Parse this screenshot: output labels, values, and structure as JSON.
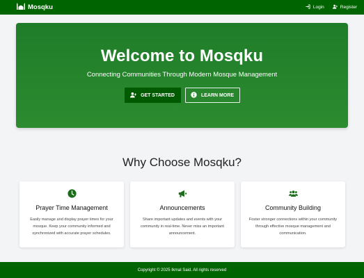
{
  "navbar": {
    "brand": "Mosqku",
    "login_label": "Login",
    "register_label": "Register"
  },
  "hero": {
    "title": "Welcome to Mosqku",
    "subtitle": "Connecting Communities Through Modern Mosque Management",
    "primary_button": "GET STARTED",
    "secondary_button": "LEARN MORE"
  },
  "features": {
    "heading": "Why Choose Mosqku?",
    "items": [
      {
        "icon": "clock-icon",
        "title": "Prayer Time Management",
        "description": "Easily manage and display prayer times for your mosque. Keep your community informed and synchronized with accurate prayer schedules."
      },
      {
        "icon": "megaphone-icon",
        "title": "Announcements",
        "description": "Share important updates and events with your community in real-time. Never miss an important announcement."
      },
      {
        "icon": "users-icon",
        "title": "Community Building",
        "description": "Foster stronger connections within your community through effective mosque management and communication."
      }
    ]
  },
  "footer": {
    "copyright": "Copyright © 2025 Ikmal Said. All rights reserved"
  },
  "colors": {
    "primary": "#006400",
    "hero": "#2c8a2f",
    "accent_icon": "#1b6b1b"
  }
}
